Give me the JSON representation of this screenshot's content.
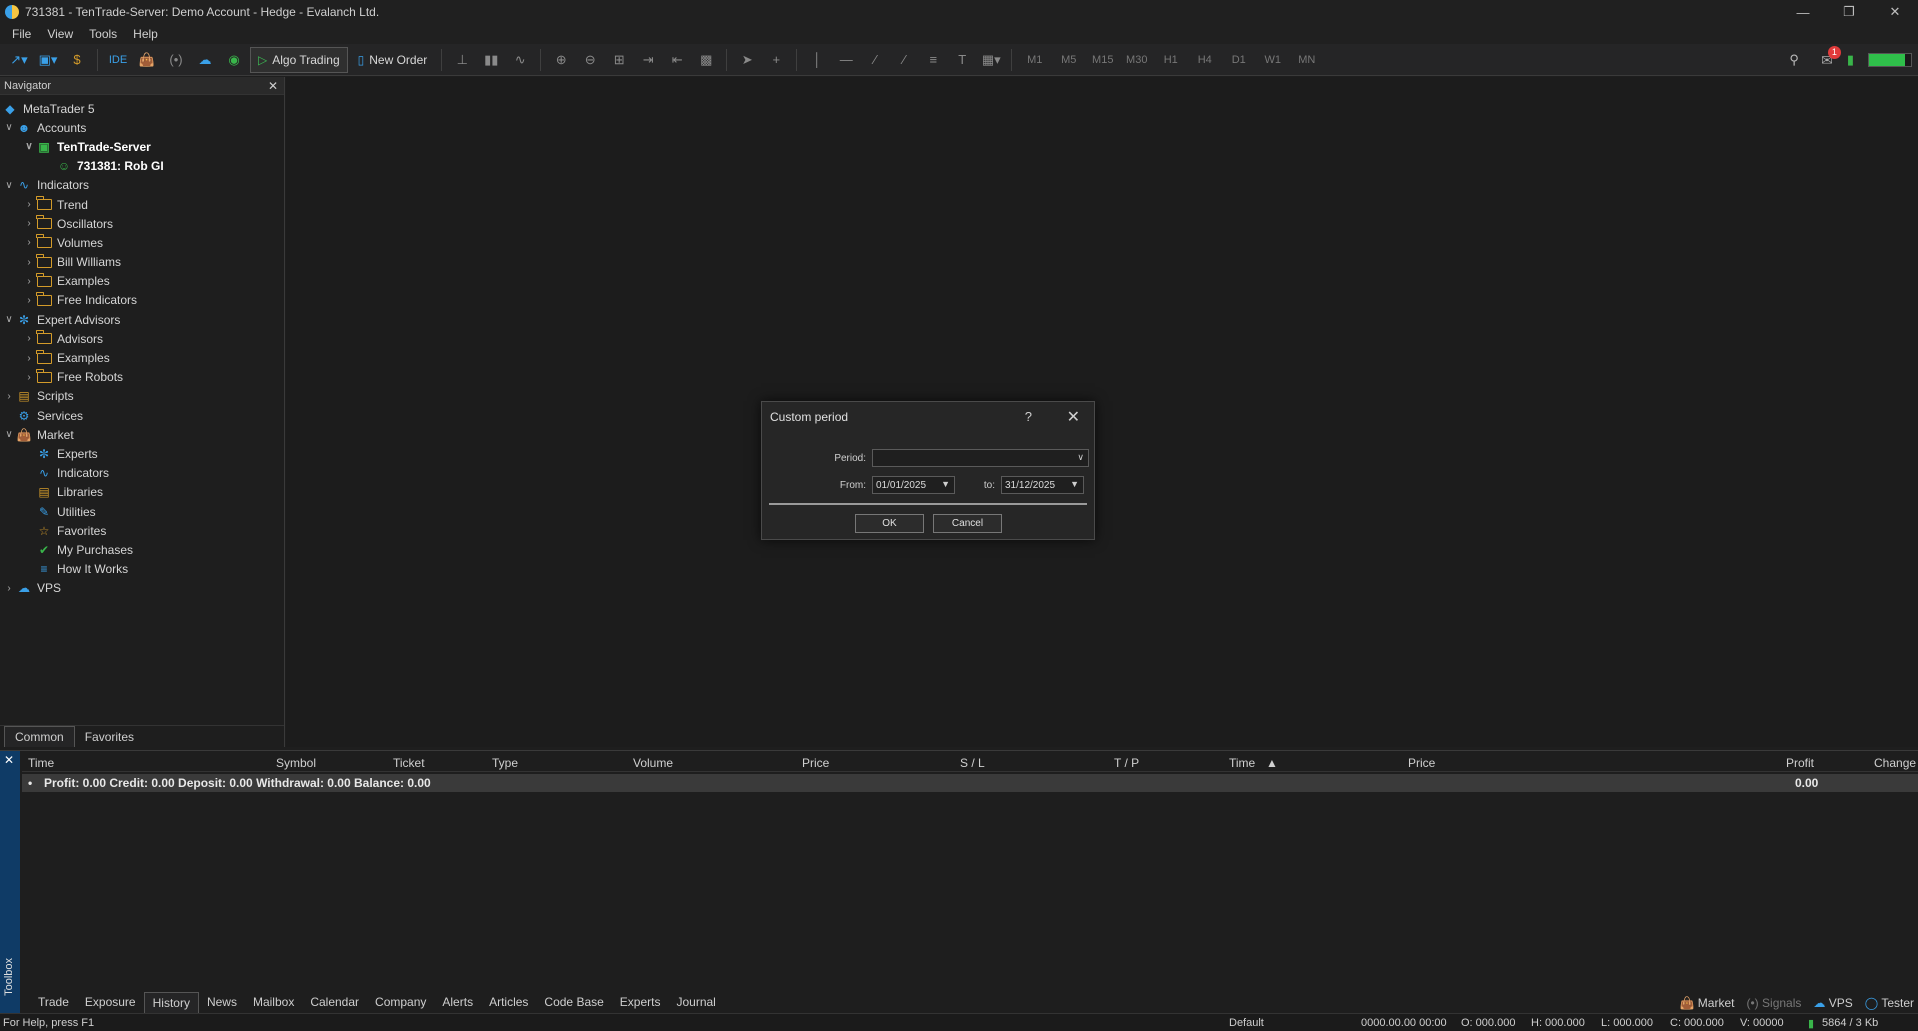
{
  "window": {
    "title": "731381 - TenTrade-Server: Demo Account - Hedge - Evalanch Ltd."
  },
  "menu": [
    "File",
    "View",
    "Tools",
    "Help"
  ],
  "toolbar": {
    "ide_label": "IDE",
    "algo_label": "Algo Trading",
    "new_order_label": "New Order",
    "timeframes": [
      "M1",
      "M5",
      "M15",
      "M30",
      "H1",
      "H4",
      "D1",
      "W1",
      "MN"
    ],
    "notification_count": "1",
    "connection_fill": 0.85
  },
  "navigator": {
    "title": "Navigator",
    "tree": {
      "root": "MetaTrader 5",
      "accounts": "Accounts",
      "server": "TenTrade-Server",
      "account": "731381: Rob GI",
      "indicators": "Indicators",
      "trend": "Trend",
      "oscillators": "Oscillators",
      "volumes": "Volumes",
      "bill_williams": "Bill Williams",
      "examples": "Examples",
      "free_indicators": "Free Indicators",
      "expert_advisors": "Expert Advisors",
      "advisors": "Advisors",
      "ea_examples": "Examples",
      "free_robots": "Free Robots",
      "scripts": "Scripts",
      "services": "Services",
      "market": "Market",
      "experts": "Experts",
      "m_indicators": "Indicators",
      "libraries": "Libraries",
      "utilities": "Utilities",
      "favorites": "Favorites",
      "my_purchases": "My Purchases",
      "how_it_works": "How It Works",
      "vps": "VPS"
    },
    "tabs": {
      "common": "Common",
      "favorites": "Favorites"
    }
  },
  "dialog": {
    "title": "Custom period",
    "help": "?",
    "period_label": "Period:",
    "period_value": "",
    "from_label": "From:",
    "from_value": "01/01/2025",
    "to_label": "to:",
    "to_value": "31/12/2025",
    "ok": "OK",
    "cancel": "Cancel"
  },
  "toolbox": {
    "label": "Toolbox",
    "columns": {
      "time": "Time",
      "symbol": "Symbol",
      "ticket": "Ticket",
      "type": "Type",
      "volume": "Volume",
      "price": "Price",
      "sl": "S / L",
      "tp": "T / P",
      "time2": "Time",
      "price2": "Price",
      "profit": "Profit",
      "change": "Change"
    },
    "summary": "Profit: 0.00  Credit: 0.00  Deposit: 0.00  Withdrawal: 0.00  Balance: 0.00",
    "summary_profit": "0.00",
    "tabs": [
      "Trade",
      "Exposure",
      "History",
      "News",
      "Mailbox",
      "Calendar",
      "Company",
      "Alerts",
      "Articles",
      "Code Base",
      "Experts",
      "Journal"
    ],
    "right": {
      "market": "Market",
      "signals": "Signals",
      "vps": "VPS",
      "tester": "Tester"
    }
  },
  "status": {
    "help": "For Help, press F1",
    "profile": "Default",
    "datetime": "0000.00.00 00:00",
    "o": "O: 000.000",
    "h": "H: 000.000",
    "l": "L: 000.000",
    "c": "C: 000.000",
    "v": "V: 00000",
    "traffic": "5864 / 3 Kb"
  },
  "colors": {
    "accent": "#3aa0e8",
    "gold": "#d39b2a",
    "green": "#39b54a",
    "toolbox_strip": "#0f3b66"
  }
}
